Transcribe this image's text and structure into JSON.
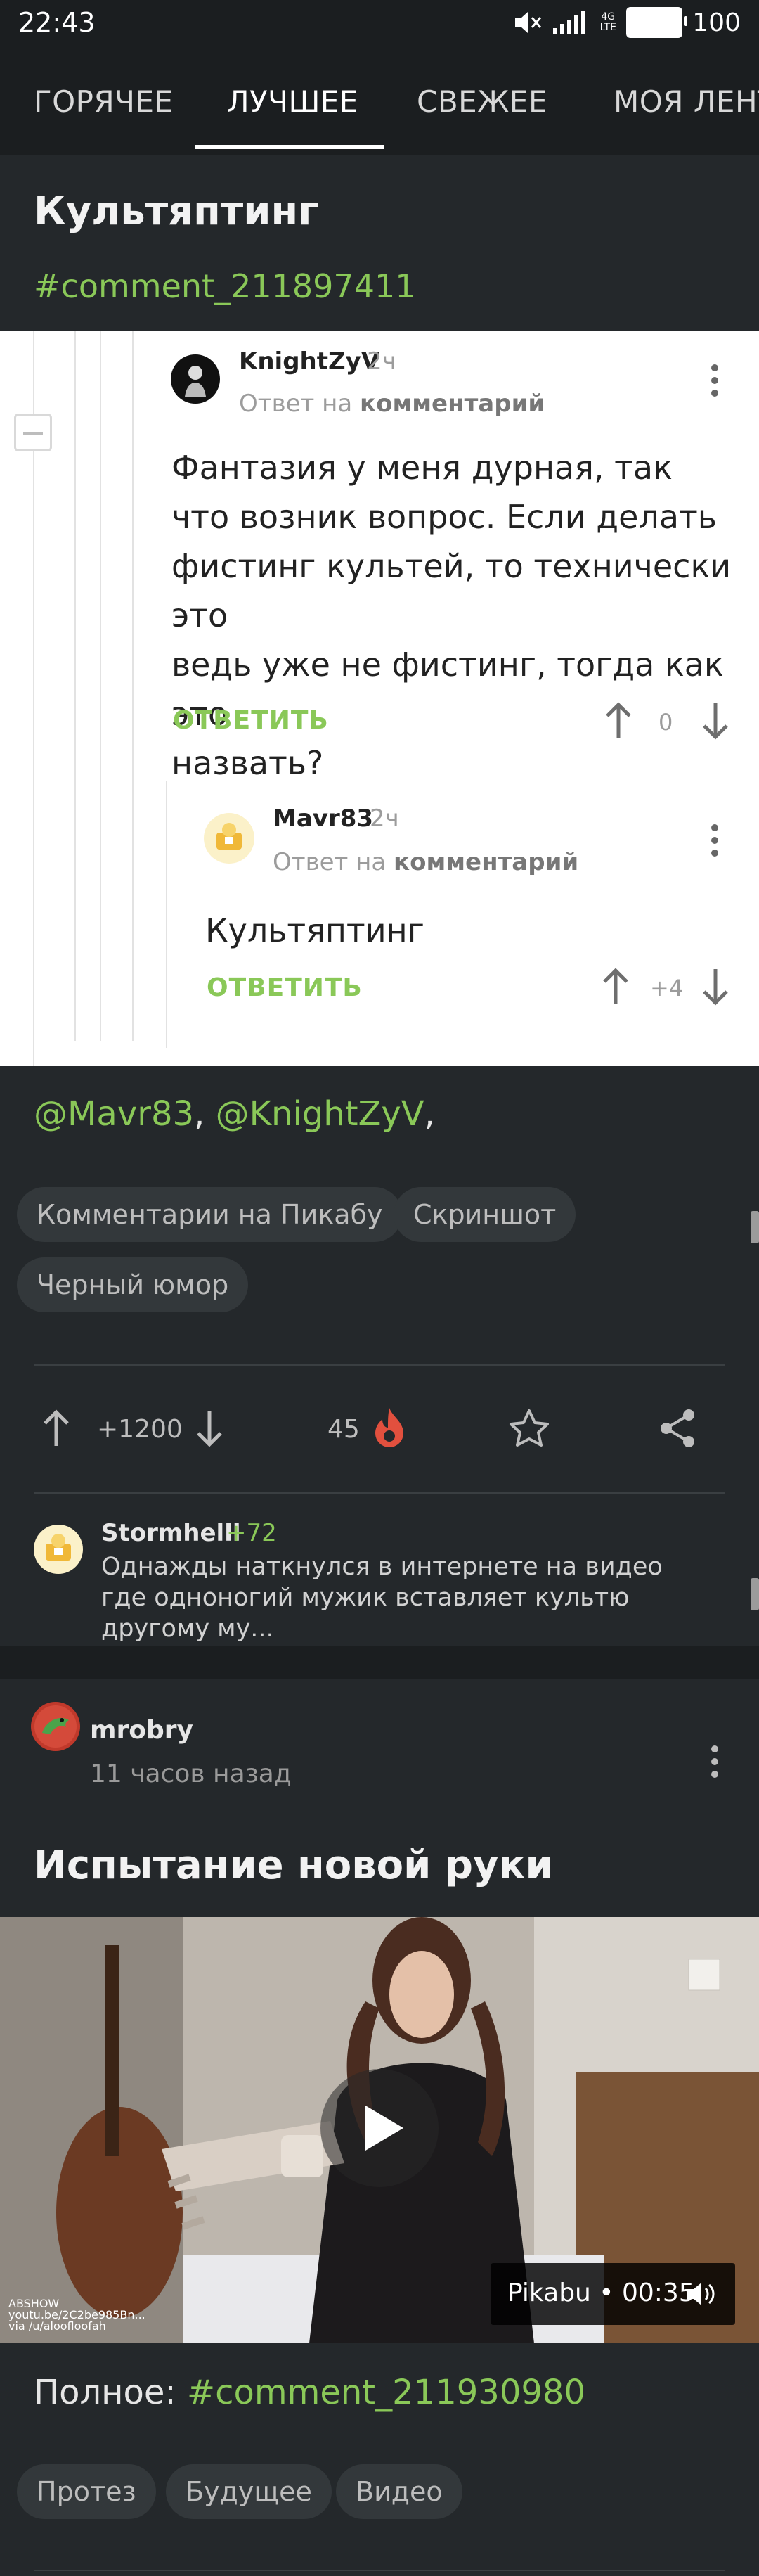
{
  "status_bar": {
    "time": "22:43",
    "network": "4G LTE",
    "battery": "100"
  },
  "tabs": [
    {
      "label": "ГОРЯЧЕЕ"
    },
    {
      "label": "ЛУЧШЕЕ",
      "active": true
    },
    {
      "label": "СВЕЖЕЕ"
    },
    {
      "label": "МОЯ ЛЕНТ"
    }
  ],
  "post1": {
    "title": "Культяптинг",
    "hashtag": "#comment_211897411",
    "screenshot": {
      "comment1": {
        "author": "KnightZyV",
        "time": "2ч",
        "reply_prefix": "Ответ на",
        "reply_link": "комментарий",
        "text_lines": [
          "Фантазия у меня дурная, так",
          "что возник вопрос. Если делать",
          "фистинг культей, то технически это",
          "ведь уже не фистинг, тогда как это",
          "назвать?"
        ],
        "answer_label": "ОТВЕТИТЬ",
        "score": "0"
      },
      "comment2": {
        "author": "Mavr83",
        "time": "2ч",
        "reply_prefix": "Ответ на",
        "reply_link": "комментарий",
        "text": "Культяптинг",
        "answer_label": "ОТВЕТИТЬ",
        "score": "+4"
      }
    },
    "mentions": {
      "first": "@Mavr83",
      "sep": ", ",
      "second": "@KnightZyV",
      "tail": ","
    },
    "tags": [
      "Комментарии на Пикабу",
      "Скриншот",
      "Черный юмор"
    ],
    "rating": "+1200",
    "comments_count": "45",
    "preview_comment": {
      "author": "Stormhelll",
      "score": "+72",
      "text": "Однажды наткнулся в интернете на видео где одноногий мужик вставляет культю другому му..."
    }
  },
  "post2": {
    "author": "mrobry",
    "time": "11 часов назад",
    "title": "Испытание новой руки",
    "video": {
      "badge": "Pikabu • 00:35",
      "watermark_lines": [
        "ABSHOW",
        "youtu.be/2C2be985Bn...",
        "via /u/aloofloofah"
      ]
    },
    "full_prefix": "Полное: ",
    "full_link": "#comment_211930980",
    "tags": [
      "Протез",
      "Будущее",
      "Видео"
    ]
  },
  "colors": {
    "accent": "#8ac858",
    "bg": "#24282b",
    "bar": "#1b1e20",
    "fire": "#e2503e"
  }
}
